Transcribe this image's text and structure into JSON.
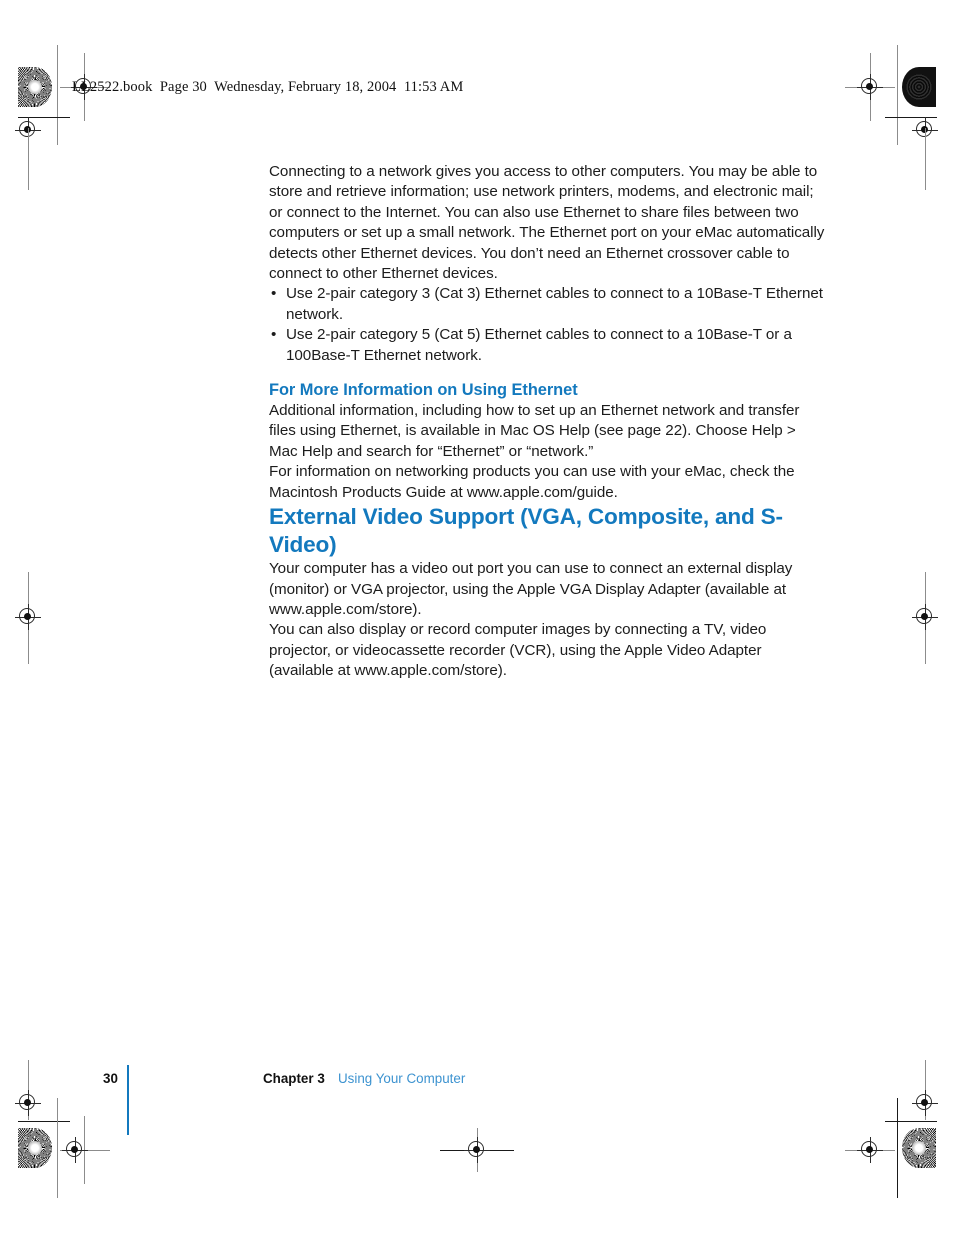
{
  "document": {
    "slug_header": "LL2522.book  Page 30  Wednesday, February 18, 2004  11:53 AM",
    "accent_color": "#1379be",
    "footer_link_color": "#3d93d0"
  },
  "content": {
    "intro_paragraph": "Connecting to a network gives you access to other computers. You may be able to store and retrieve information; use network printers, modems, and electronic mail; or connect to the Internet. You can also use Ethernet to share files between two computers or set up a small network. The Ethernet port on your eMac automatically detects other Ethernet devices. You don’t need an Ethernet crossover cable to connect to other Ethernet devices.",
    "bullets": [
      "Use 2-pair category 3 (Cat 3) Ethernet cables to connect to a 10Base-T Ethernet network.",
      "Use 2-pair category 5 (Cat 5) Ethernet cables to connect to a 10Base-T or a 100Base-T Ethernet network."
    ],
    "bullet_marker": "•",
    "subheading": "For More Information on Using Ethernet",
    "subheading_paragraph": "Additional information, including how to set up an Ethernet network and transfer files using Ethernet, is available in Mac OS Help (see page 22). Choose Help > Mac Help and search for “Ethernet” or “network.”",
    "products_guide_paragraph": "For information on networking products you can use with your eMac, check the Macintosh Products Guide at www.apple.com/guide.",
    "section_heading": "External Video Support (VGA, Composite, and S-Video)",
    "video_paragraph_1": "Your computer has a video out port you can use to connect an external display (monitor) or VGA projector, using the Apple VGA Display Adapter (available at www.apple.com/store).",
    "video_paragraph_2": "You can also display or record computer images by connecting a TV, video projector, or videocassette recorder (VCR), using the Apple Video Adapter (available at www.apple.com/store)."
  },
  "footer": {
    "page_number": "30",
    "chapter_label": "Chapter 3",
    "chapter_title": "Using Your Computer"
  }
}
